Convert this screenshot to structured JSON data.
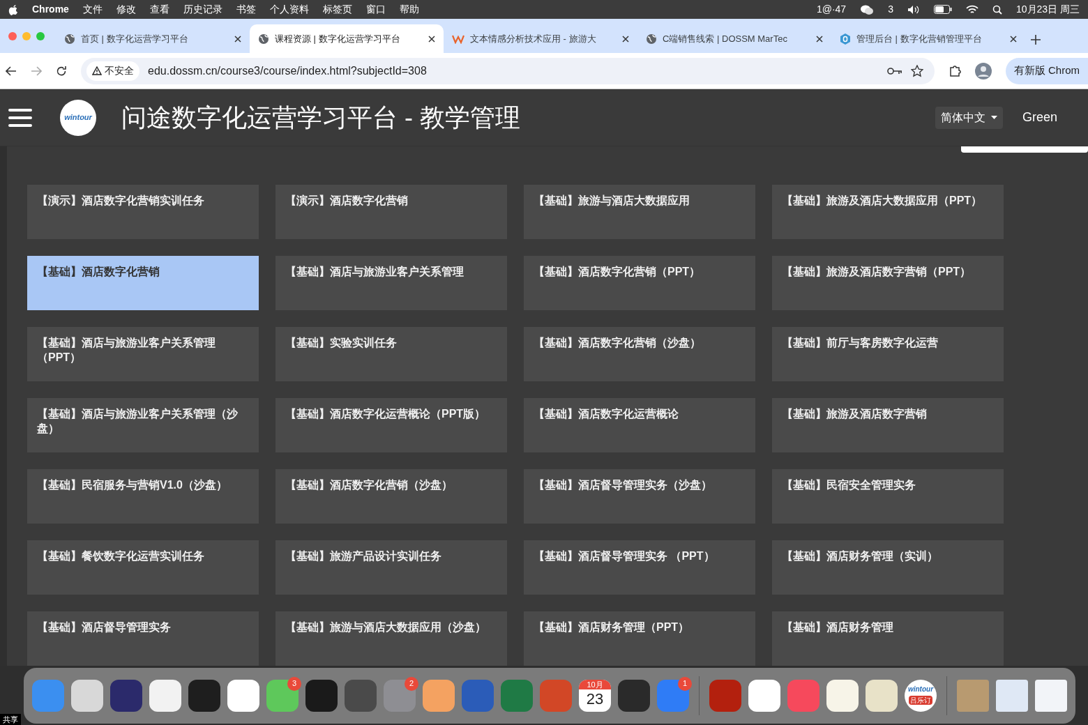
{
  "menu_bar": {
    "app": "Chrome",
    "items": [
      "文件",
      "修改",
      "查看",
      "历史记录",
      "书签",
      "个人资料",
      "标签页",
      "窗口",
      "帮助"
    ],
    "status_text": "1@·47",
    "wechat_count": "3",
    "clock": "10月23日 周三"
  },
  "tabs": [
    {
      "title": "首页 | 数字化运营学习平台",
      "selected": false,
      "kind": "globe"
    },
    {
      "title": "课程资源 | 数字化运营学习平台",
      "selected": true,
      "kind": "globe"
    },
    {
      "title": "文本情感分析技术应用 - 旅游大",
      "selected": false,
      "kind": "wlogo"
    },
    {
      "title": "C端销售线索 | DOSSM MarTec",
      "selected": false,
      "kind": "globe"
    },
    {
      "title": "管理后台 | 数字化营销管理平台",
      "selected": false,
      "kind": "hexlogo"
    }
  ],
  "address_bar": {
    "security": "不安全",
    "url": "edu.dossm.cn/course3/course/index.html?subjectId=308",
    "update_button": "有新版 Chrom"
  },
  "header": {
    "logo_text": "wintour",
    "title": "问途数字化运营学习平台 - 教学管理",
    "language": "简体中文",
    "user": "Green"
  },
  "courses": [
    {
      "title": "【演示】酒店数字化营销实训任务",
      "selected": false
    },
    {
      "title": "【演示】酒店数字化营销",
      "selected": false
    },
    {
      "title": "【基础】旅游与酒店大数据应用",
      "selected": false
    },
    {
      "title": "【基础】旅游及酒店大数据应用（PPT）",
      "selected": false
    },
    {
      "title": "【基础】酒店数字化营销",
      "selected": true
    },
    {
      "title": "【基础】酒店与旅游业客户关系管理",
      "selected": false
    },
    {
      "title": "【基础】酒店数字化营销（PPT）",
      "selected": false
    },
    {
      "title": "【基础】旅游及酒店数字营销（PPT）",
      "selected": false
    },
    {
      "title": "【基础】酒店与旅游业客户关系管理（PPT）",
      "selected": false
    },
    {
      "title": "【基础】实验实训任务",
      "selected": false
    },
    {
      "title": "【基础】酒店数字化营销（沙盘）",
      "selected": false
    },
    {
      "title": "【基础】前厅与客房数字化运营",
      "selected": false
    },
    {
      "title": "【基础】酒店与旅游业客户关系管理（沙盘）",
      "selected": false
    },
    {
      "title": "【基础】酒店数字化运营概论（PPT版）",
      "selected": false
    },
    {
      "title": "【基础】酒店数字化运营概论",
      "selected": false
    },
    {
      "title": "【基础】旅游及酒店数字营销",
      "selected": false
    },
    {
      "title": "【基础】民宿服务与营销V1.0（沙盘）",
      "selected": false
    },
    {
      "title": "【基础】酒店数字化营销（沙盘）",
      "selected": false
    },
    {
      "title": "【基础】酒店督导管理实务（沙盘）",
      "selected": false
    },
    {
      "title": "【基础】民宿安全管理实务",
      "selected": false
    },
    {
      "title": "【基础】餐饮数字化运营实训任务",
      "selected": false
    },
    {
      "title": "【基础】旅游产品设计实训任务",
      "selected": false
    },
    {
      "title": "【基础】酒店督导管理实务 （PPT）",
      "selected": false
    },
    {
      "title": "【基础】酒店财务管理（实训）",
      "selected": false
    },
    {
      "title": "【基础】酒店督导管理实务",
      "selected": false
    },
    {
      "title": "【基础】旅游与酒店大数据应用（沙盘）",
      "selected": false
    },
    {
      "title": "【基础】酒店财务管理（PPT）",
      "selected": false
    },
    {
      "title": "【基础】酒店财务管理",
      "selected": false
    }
  ],
  "dock": {
    "share_label": "共享",
    "apps": [
      {
        "kind": "finder",
        "color": "#3b8ff0"
      },
      {
        "kind": "launchpad",
        "color": "#d8d8d8"
      },
      {
        "kind": "firefox",
        "color": "#2b2a6b"
      },
      {
        "kind": "chrome",
        "color": "#f2f2f2"
      },
      {
        "kind": "qq",
        "color": "#1e1e1e"
      },
      {
        "kind": "chat",
        "color": "#ffffff"
      },
      {
        "kind": "wechat",
        "color": "#5ec85b",
        "badge": "3"
      },
      {
        "kind": "terminal",
        "color": "#1a1a1a"
      },
      {
        "kind": "sublime",
        "color": "#4a4a4a"
      },
      {
        "kind": "settings",
        "color": "#8e8e93",
        "badge": "2"
      },
      {
        "kind": "navicat",
        "color": "#f4a261"
      },
      {
        "kind": "word",
        "color": "#2b5cb8"
      },
      {
        "kind": "excel",
        "color": "#1f7a45"
      },
      {
        "kind": "powerpoint",
        "color": "#d24726"
      },
      {
        "kind": "calendar",
        "color": "#ffffff",
        "month": "10月",
        "day": "23"
      },
      {
        "kind": "quicktime",
        "color": "#2a2a2a"
      },
      {
        "kind": "lark",
        "color": "#2f7cf6",
        "badge": "1"
      },
      {
        "kind": "separator"
      },
      {
        "kind": "acrobat",
        "color": "#b3200e"
      },
      {
        "kind": "mail",
        "color": "#ffffff"
      },
      {
        "kind": "music",
        "color": "#f6495c"
      },
      {
        "kind": "notes",
        "color": "#f7f4e8"
      },
      {
        "kind": "chart",
        "color": "#e8e2c8"
      },
      {
        "kind": "wintour",
        "color": "#ffffff",
        "text": "wintour",
        "subtext": "吕乐订"
      },
      {
        "kind": "separator"
      },
      {
        "kind": "thumb",
        "color": "#b89a70"
      },
      {
        "kind": "thumb",
        "color": "#dfe8f5"
      },
      {
        "kind": "thumb",
        "color": "#f2f4f8"
      }
    ]
  }
}
